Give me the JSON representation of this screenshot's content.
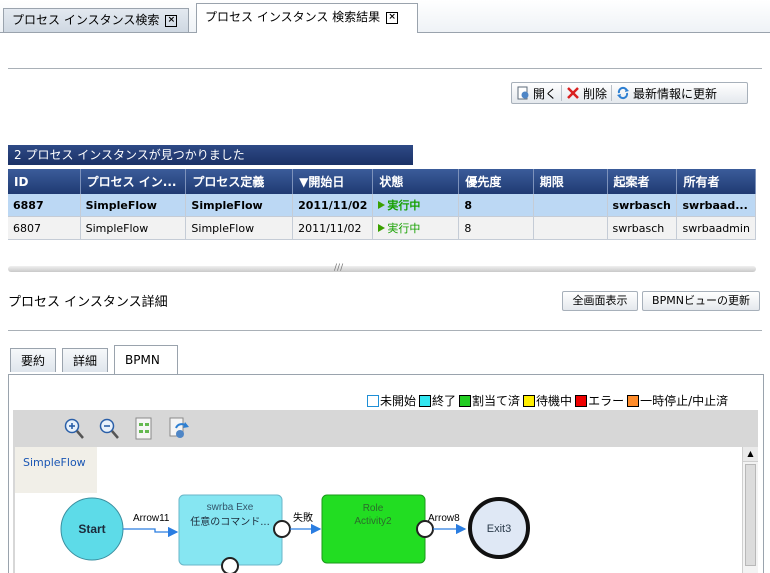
{
  "tabs": [
    {
      "label": "プロセス インスタンス検索",
      "active": false
    },
    {
      "label": "プロセス インスタンス 検索結果",
      "active": true
    }
  ],
  "toolbar": {
    "open": "開く",
    "delete": "削除",
    "refresh": "最新情報に更新"
  },
  "results": {
    "caption": "2 プロセス インスタンスが見つかりました",
    "columns": [
      "ID",
      "プロセス イン...",
      "プロセス定義",
      "▼開始日",
      "状態",
      "優先度",
      "期限",
      "起案者",
      "所有者"
    ],
    "rows": [
      {
        "id": "6887",
        "instance": "SimpleFlow",
        "definition": "SimpleFlow",
        "start": "2011/11/02",
        "status": "実行中",
        "priority": "8",
        "due": "",
        "initiator": "swrbasch",
        "owner": "swrbaad...",
        "selected": true
      },
      {
        "id": "6807",
        "instance": "SimpleFlow",
        "definition": "SimpleFlow",
        "start": "2011/11/02",
        "status": "実行中",
        "priority": "8",
        "due": "",
        "initiator": "swrbasch",
        "owner": "swrbaadmin",
        "selected": false
      }
    ]
  },
  "splitter_grip": "///",
  "detail": {
    "title": "プロセス インスタンス詳細",
    "fullscreen_button": "全画面表示",
    "bpmn_refresh_button": "BPMNビューの更新",
    "tabs": [
      "要約",
      "詳細",
      "BPMN"
    ],
    "active_tab": "BPMN"
  },
  "legend": [
    {
      "label": "未開始",
      "color": "#ffffff"
    },
    {
      "label": "終了",
      "color": "#33e6f0"
    },
    {
      "label": "割当て済",
      "color": "#22cc22"
    },
    {
      "label": "待機中",
      "color": "#ffee00"
    },
    {
      "label": "エラー",
      "color": "#ee0000"
    },
    {
      "label": "一時停止/中止済",
      "color": "#ff8c2a"
    }
  ],
  "diagram": {
    "pool_name": "SimpleFlow",
    "start_label": "Start",
    "arrow1": "Arrow11",
    "task1_line1": "swrba  Exe",
    "task1_line2": "任意のコマンド...",
    "fail_label": "失敗",
    "task2_line1": "Role",
    "task2_line2": "Activity2",
    "arrow2": "Arrow8",
    "exit_label": "Exit3",
    "scroll_up": "▲"
  },
  "colors": {
    "tab_border": "#9aa3ad",
    "header_blue": "#1f3a72",
    "selected_row": "#bcd8f4",
    "start_fill": "#5ddbe8",
    "task_done": "#86e6f2",
    "task_assigned": "#22dd22",
    "exit_fill": "#dfe8f5"
  }
}
